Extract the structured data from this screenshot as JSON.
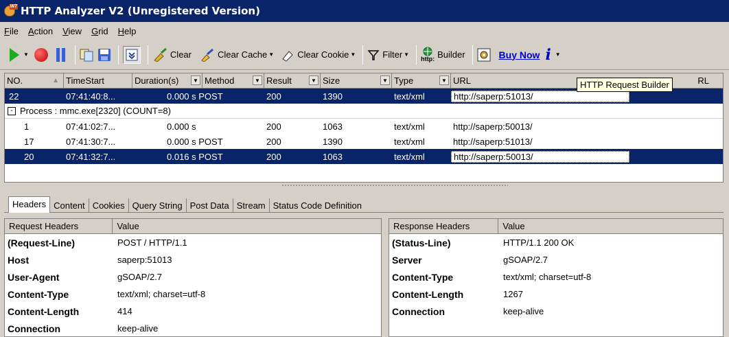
{
  "window": {
    "title": "HTTP Analyzer V2  (Unregistered Version)",
    "icon_badge": "W7"
  },
  "menu": [
    "File",
    "Action",
    "View",
    "Grid",
    "Help"
  ],
  "toolbar": {
    "clear": "Clear",
    "clear_cache": "Clear Cache",
    "clear_cookie": "Clear Cookie",
    "filter": "Filter",
    "builder": "Builder",
    "builder_http": "http:",
    "buy_now": "Buy Now",
    "info": "i"
  },
  "tooltip": "HTTP Request Builder",
  "grid": {
    "columns": [
      "NO.",
      "TimeStart",
      "Duration(s)",
      "Method",
      "Result",
      "Size",
      "Type",
      "URL"
    ],
    "url_col_tail": "RL",
    "row_top": {
      "no": "22",
      "time": "07:41:40:8...",
      "duration": "0.000 s POST",
      "result": "200",
      "size": "1390",
      "type": "text/xml",
      "url": "http://saperp:51013/"
    },
    "group": {
      "label": "Process : mmc.exe[2320] (COUNT=8)",
      "toggle": "-"
    },
    "rows": [
      {
        "no": "1",
        "time": "07:41:02:7...",
        "duration": "0.000 s",
        "result": "200",
        "size": "1063",
        "type": "text/xml",
        "url": "http://saperp:50013/"
      },
      {
        "no": "17",
        "time": "07:41:30:7...",
        "duration": "0.000 s POST",
        "result": "200",
        "size": "1390",
        "type": "text/xml",
        "url": "http://saperp:51013/"
      },
      {
        "no": "20",
        "time": "07:41:32:7...",
        "duration": "0.016 s POST",
        "result": "200",
        "size": "1063",
        "type": "text/xml",
        "url": "http://saperp:50013/"
      }
    ]
  },
  "tabs": [
    "Headers",
    "Content",
    "Cookies",
    "Query String",
    "Post Data",
    "Stream",
    "Status Code Definition"
  ],
  "request": {
    "col1": "Request Headers",
    "col2": "Value",
    "rows": [
      {
        "k": "(Request-Line)",
        "v": "POST / HTTP/1.1"
      },
      {
        "k": "Host",
        "v": "saperp:51013"
      },
      {
        "k": "User-Agent",
        "v": "gSOAP/2.7"
      },
      {
        "k": "Content-Type",
        "v": "text/xml; charset=utf-8"
      },
      {
        "k": "Content-Length",
        "v": "414"
      },
      {
        "k": "Connection",
        "v": "keep-alive"
      }
    ]
  },
  "response": {
    "col1": "Response Headers",
    "col2": "Value",
    "rows": [
      {
        "k": "(Status-Line)",
        "v": "HTTP/1.1 200 OK"
      },
      {
        "k": "Server",
        "v": "gSOAP/2.7"
      },
      {
        "k": "Content-Type",
        "v": "text/xml; charset=utf-8"
      },
      {
        "k": "Content-Length",
        "v": "1267"
      },
      {
        "k": "Connection",
        "v": "keep-alive"
      }
    ]
  }
}
